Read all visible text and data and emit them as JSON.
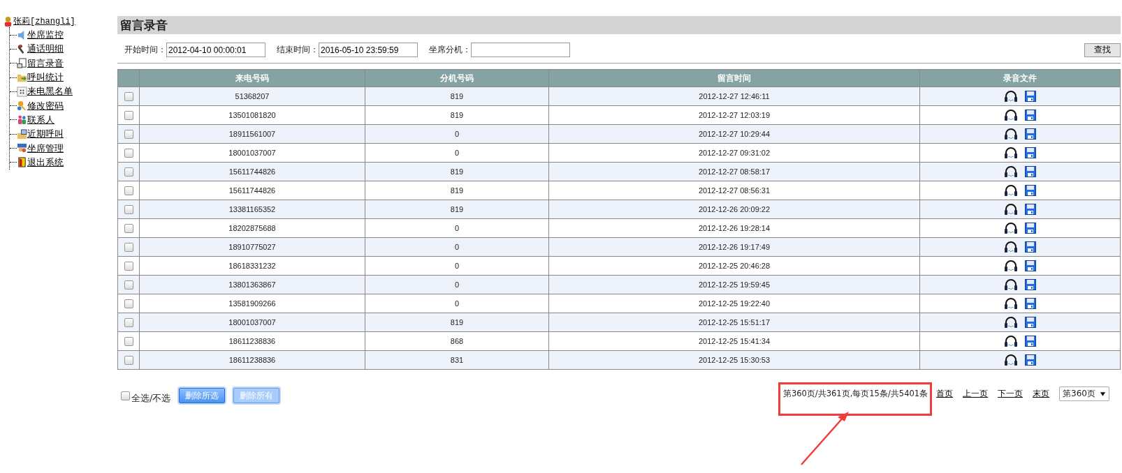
{
  "sidebar": {
    "user": "张莉[zhangli]",
    "items": [
      {
        "label": "坐席监控",
        "kind": "speaker"
      },
      {
        "label": "通话明细",
        "kind": "phone"
      },
      {
        "label": "留言录音",
        "kind": "doc"
      },
      {
        "label": "呼叫统计",
        "kind": "folder-arrow"
      },
      {
        "label": "来电黑名单",
        "kind": "keypad"
      },
      {
        "label": "修改密码",
        "kind": "key"
      },
      {
        "label": "联系人",
        "kind": "people"
      },
      {
        "label": "近期呼叫",
        "kind": "folder-screen"
      },
      {
        "label": "坐席管理",
        "kind": "manager"
      },
      {
        "label": "退出系统",
        "kind": "exit"
      }
    ]
  },
  "page_title": "留言录音",
  "filters": [
    {
      "label": "开始时间：",
      "value": "2012-04-10 00:00:01"
    },
    {
      "label": "结束时间：",
      "value": "2016-05-10 23:59:59"
    },
    {
      "label": "坐席分机："
    }
  ],
  "search_button": "查找",
  "table": {
    "columns": [
      "来电号码",
      "分机号码",
      "留言时间",
      "录音文件"
    ],
    "rows": [
      {
        "checked": false,
        "caller": "51368207",
        "extension": "819",
        "time": "2012-12-27 12:46:11"
      },
      {
        "checked": false,
        "caller": "13501081820",
        "extension": "819",
        "time": "2012-12-27 12:03:19"
      },
      {
        "checked": false,
        "caller": "18911561007",
        "extension": "0",
        "time": "2012-12-27 10:29:44"
      },
      {
        "checked": false,
        "caller": "18001037007",
        "extension": "0",
        "time": "2012-12-27 09:31:02"
      },
      {
        "checked": false,
        "caller": "15611744826",
        "extension": "819",
        "time": "2012-12-27 08:58:17"
      },
      {
        "checked": false,
        "caller": "15611744826",
        "extension": "819",
        "time": "2012-12-27 08:56:31"
      },
      {
        "checked": false,
        "caller": "13381165352",
        "extension": "819",
        "time": "2012-12-26 20:09:22"
      },
      {
        "checked": false,
        "caller": "18202875688",
        "extension": "0",
        "time": "2012-12-26 19:28:14"
      },
      {
        "checked": false,
        "caller": "18910775027",
        "extension": "0",
        "time": "2012-12-26 19:17:49"
      },
      {
        "checked": false,
        "caller": "18618331232",
        "extension": "0",
        "time": "2012-12-25 20:46:28"
      },
      {
        "checked": false,
        "caller": "13801363867",
        "extension": "0",
        "time": "2012-12-25 19:59:45"
      },
      {
        "checked": false,
        "caller": "13581909266",
        "extension": "0",
        "time": "2012-12-25 19:22:40"
      },
      {
        "checked": false,
        "caller": "18001037007",
        "extension": "819",
        "time": "2012-12-25 15:51:17"
      },
      {
        "checked": false,
        "caller": "18611238836",
        "extension": "868",
        "time": "2012-12-25 15:41:34"
      },
      {
        "checked": false,
        "caller": "18611238836",
        "extension": "831",
        "time": "2012-12-25 15:30:53"
      }
    ]
  },
  "select_all": {
    "label": "全选/不选",
    "checked": false
  },
  "buttons": [
    {
      "label": "删除所选",
      "disabled": false
    },
    {
      "label": "删除所有",
      "disabled": true
    }
  ],
  "pagination": {
    "summary": "第360页/共361页,每页15条/共5401条",
    "links": [
      "首页",
      "上一页",
      "下一页",
      "末页"
    ],
    "page_select": "第360页"
  },
  "annotation": {
    "kind": "box-arrow"
  }
}
